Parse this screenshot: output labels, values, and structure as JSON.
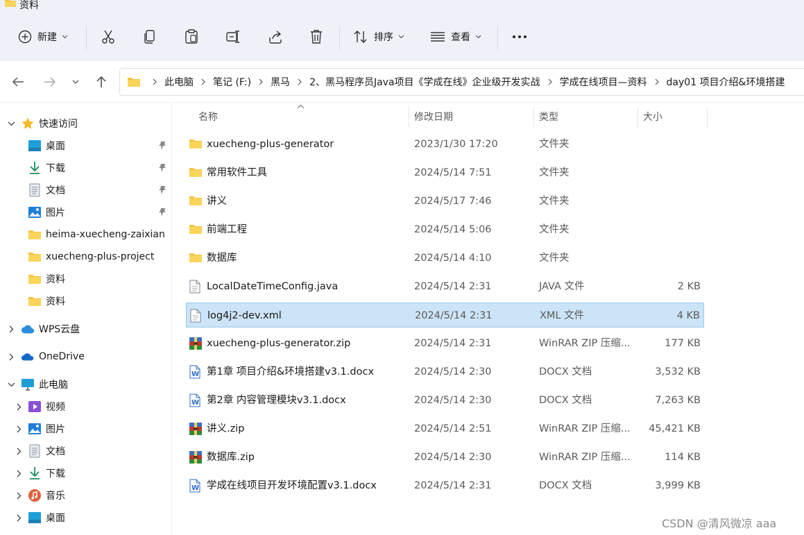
{
  "window": {
    "title": "资料"
  },
  "toolbar": {
    "new_label": "新建",
    "sort_label": "排序",
    "view_label": "查看"
  },
  "address": {
    "crumbs": [
      "此电脑",
      "笔记 (F:)",
      "黑马",
      "2、黑马程序员Java项目《学成在线》企业级开发实战",
      "学成在线项目—资料",
      "day01 项目介绍&环境搭建"
    ]
  },
  "sidebar": {
    "quick_access": "快速访问",
    "quick_items": [
      "桌面",
      "下载",
      "文档",
      "图片",
      "heima-xuecheng-zaixian",
      "xuecheng-plus-project",
      "资料",
      "资料"
    ],
    "wps": "WPS云盘",
    "onedrive": "OneDrive",
    "this_pc": "此电脑",
    "pc_items": [
      "视频",
      "图片",
      "文档",
      "下载",
      "音乐",
      "桌面"
    ]
  },
  "columns": {
    "name": "名称",
    "date": "修改日期",
    "type": "类型",
    "size": "大小"
  },
  "files": [
    {
      "name": "xuecheng-plus-generator",
      "date": "2023/1/30 17:20",
      "type": "文件夹",
      "size": "",
      "icon": "folder-icon"
    },
    {
      "name": "常用软件工具",
      "date": "2024/5/14 7:51",
      "type": "文件夹",
      "size": "",
      "icon": "folder-icon"
    },
    {
      "name": "讲义",
      "date": "2024/5/17 7:46",
      "type": "文件夹",
      "size": "",
      "icon": "folder-icon"
    },
    {
      "name": "前端工程",
      "date": "2024/5/14 5:06",
      "type": "文件夹",
      "size": "",
      "icon": "folder-icon"
    },
    {
      "name": "数据库",
      "date": "2024/5/14 4:10",
      "type": "文件夹",
      "size": "",
      "icon": "folder-icon"
    },
    {
      "name": "LocalDateTimeConfig.java",
      "date": "2024/5/14 2:31",
      "type": "JAVA 文件",
      "size": "2 KB",
      "icon": "document-icon"
    },
    {
      "name": "log4j2-dev.xml",
      "date": "2024/5/14 2:31",
      "type": "XML 文件",
      "size": "4 KB",
      "icon": "document-icon"
    },
    {
      "name": "xuecheng-plus-generator.zip",
      "date": "2024/5/14 2:31",
      "type": "WinRAR ZIP 压缩...",
      "size": "177 KB",
      "icon": "winrar-icon"
    },
    {
      "name": "第1章 项目介绍&环境搭建v3.1.docx",
      "date": "2024/5/14 2:30",
      "type": "DOCX 文档",
      "size": "3,532 KB",
      "icon": "word-doc-icon"
    },
    {
      "name": "第2章 内容管理模块v3.1.docx",
      "date": "2024/5/14 2:30",
      "type": "DOCX 文档",
      "size": "7,263 KB",
      "icon": "word-doc-icon"
    },
    {
      "name": "讲义.zip",
      "date": "2024/5/14 2:51",
      "type": "WinRAR ZIP 压缩...",
      "size": "45,421 KB",
      "icon": "winrar-icon"
    },
    {
      "name": "数据库.zip",
      "date": "2024/5/14 2:30",
      "type": "WinRAR ZIP 压缩...",
      "size": "114 KB",
      "icon": "winrar-icon"
    },
    {
      "name": "学成在线项目开发环境配置v3.1.docx",
      "date": "2024/5/14 2:31",
      "type": "DOCX 文档",
      "size": "3,999 KB",
      "icon": "word-doc-icon"
    }
  ],
  "watermark": "CSDN @清风微凉 aaa",
  "colors": {
    "folder": "#f5c342",
    "selected_bg": "#cce4f7",
    "selected_border": "#99c9ef",
    "chrome_bg": "#eef1f8"
  }
}
